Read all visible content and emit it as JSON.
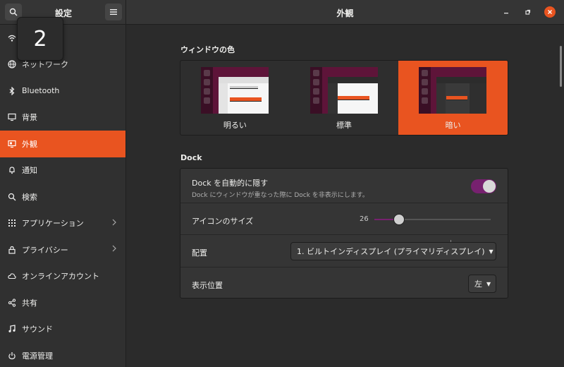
{
  "header": {
    "sidebar_title": "設定",
    "main_title": "外観"
  },
  "workspace_badge": "2",
  "sidebar": {
    "items": [
      {
        "label": "",
        "icon": "wifi-icon"
      },
      {
        "label": "ネットワーク",
        "icon": "globe-icon"
      },
      {
        "label": "Bluetooth",
        "icon": "bluetooth-icon"
      },
      {
        "label": "背景",
        "icon": "monitor-icon"
      },
      {
        "label": "外観",
        "icon": "appearance-icon",
        "active": true
      },
      {
        "label": "通知",
        "icon": "bell-icon"
      },
      {
        "label": "検索",
        "icon": "search-icon"
      },
      {
        "label": "アプリケーション",
        "icon": "grid-icon",
        "chevron": true
      },
      {
        "label": "プライバシー",
        "icon": "lock-icon",
        "chevron": true
      },
      {
        "label": "オンラインアカウント",
        "icon": "cloud-icon"
      },
      {
        "label": "共有",
        "icon": "share-icon"
      },
      {
        "label": "サウンド",
        "icon": "music-icon"
      },
      {
        "label": "電源管理",
        "icon": "power-icon"
      }
    ]
  },
  "window_color": {
    "title": "ウィンドウの色",
    "options": [
      {
        "label": "明るい"
      },
      {
        "label": "標準"
      },
      {
        "label": "暗い",
        "selected": true
      }
    ]
  },
  "dock": {
    "title": "Dock",
    "autohide_label": "Dock を自動的に隠す",
    "autohide_sub": "Dock にウィンドウが重なった際に Dock を非表示にします。",
    "autohide_on": true,
    "icon_size_label": "アイコンのサイズ",
    "icon_size_value": "26",
    "icon_size_fraction": 0.21,
    "placement_label": "配置",
    "placement_value": "1. ビルトインディスプレイ (プライマリディスプレイ)",
    "position_label": "表示位置",
    "position_value": "左"
  },
  "colors": {
    "accent": "#e95420",
    "toggle": "#77216f"
  }
}
